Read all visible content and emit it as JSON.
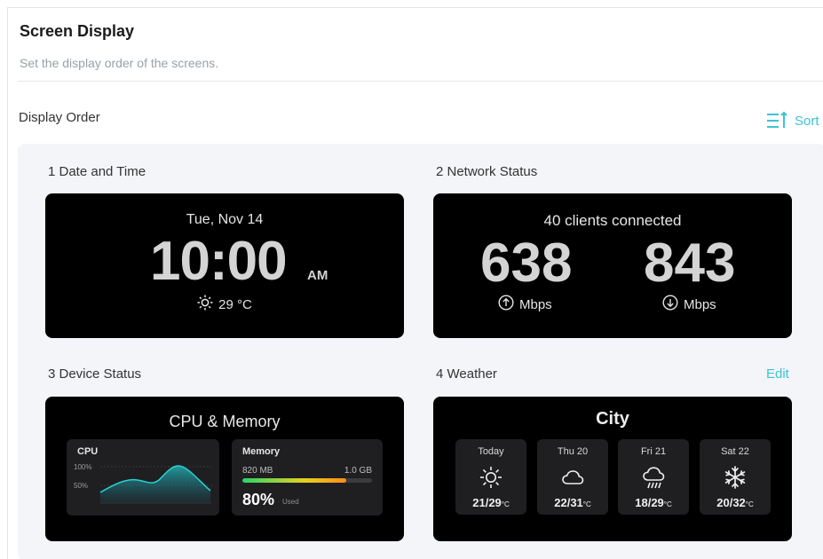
{
  "header": {
    "title": "Screen Display",
    "subtitle": "Set the display order of the screens."
  },
  "display_order": {
    "label": "Display Order",
    "sort_label": "Sort",
    "edit_label": "Edit"
  },
  "accent_color": "#3cc3d4",
  "cards": {
    "date_time": {
      "label": "1 Date and Time",
      "date": "Tue, Nov 14",
      "time": "10:00",
      "ampm": "AM",
      "temperature": "29 °C",
      "weather_icon": "sun-icon"
    },
    "network": {
      "label": "2 Network Status",
      "clients": "40 clients connected",
      "upload_value": "638",
      "upload_unit": "Mbps",
      "download_value": "843",
      "download_unit": "Mbps"
    },
    "device": {
      "label": "3 Device Status",
      "title": "CPU & Memory",
      "cpu_title": "CPU",
      "cpu_tick_high": "100%",
      "cpu_tick_mid": "50%",
      "memory_title": "Memory",
      "memory_used": "820 MB",
      "memory_total": "1.0 GB",
      "memory_percent": "80%",
      "memory_percent_value": 0.8,
      "memory_used_label": "Used"
    },
    "weather": {
      "label": "4 Weather",
      "city": "City",
      "days": [
        {
          "name": "Today",
          "low": "21",
          "high": "29",
          "unit": "°C",
          "icon": "sun-icon"
        },
        {
          "name": "Thu 20",
          "low": "22",
          "high": "31",
          "unit": "°C",
          "icon": "cloud-icon"
        },
        {
          "name": "Fri 21",
          "low": "18",
          "high": "29",
          "unit": "°C",
          "icon": "rain-icon"
        },
        {
          "name": "Sat 22",
          "low": "20",
          "high": "32",
          "unit": "°C",
          "icon": "snow-icon"
        }
      ]
    }
  }
}
